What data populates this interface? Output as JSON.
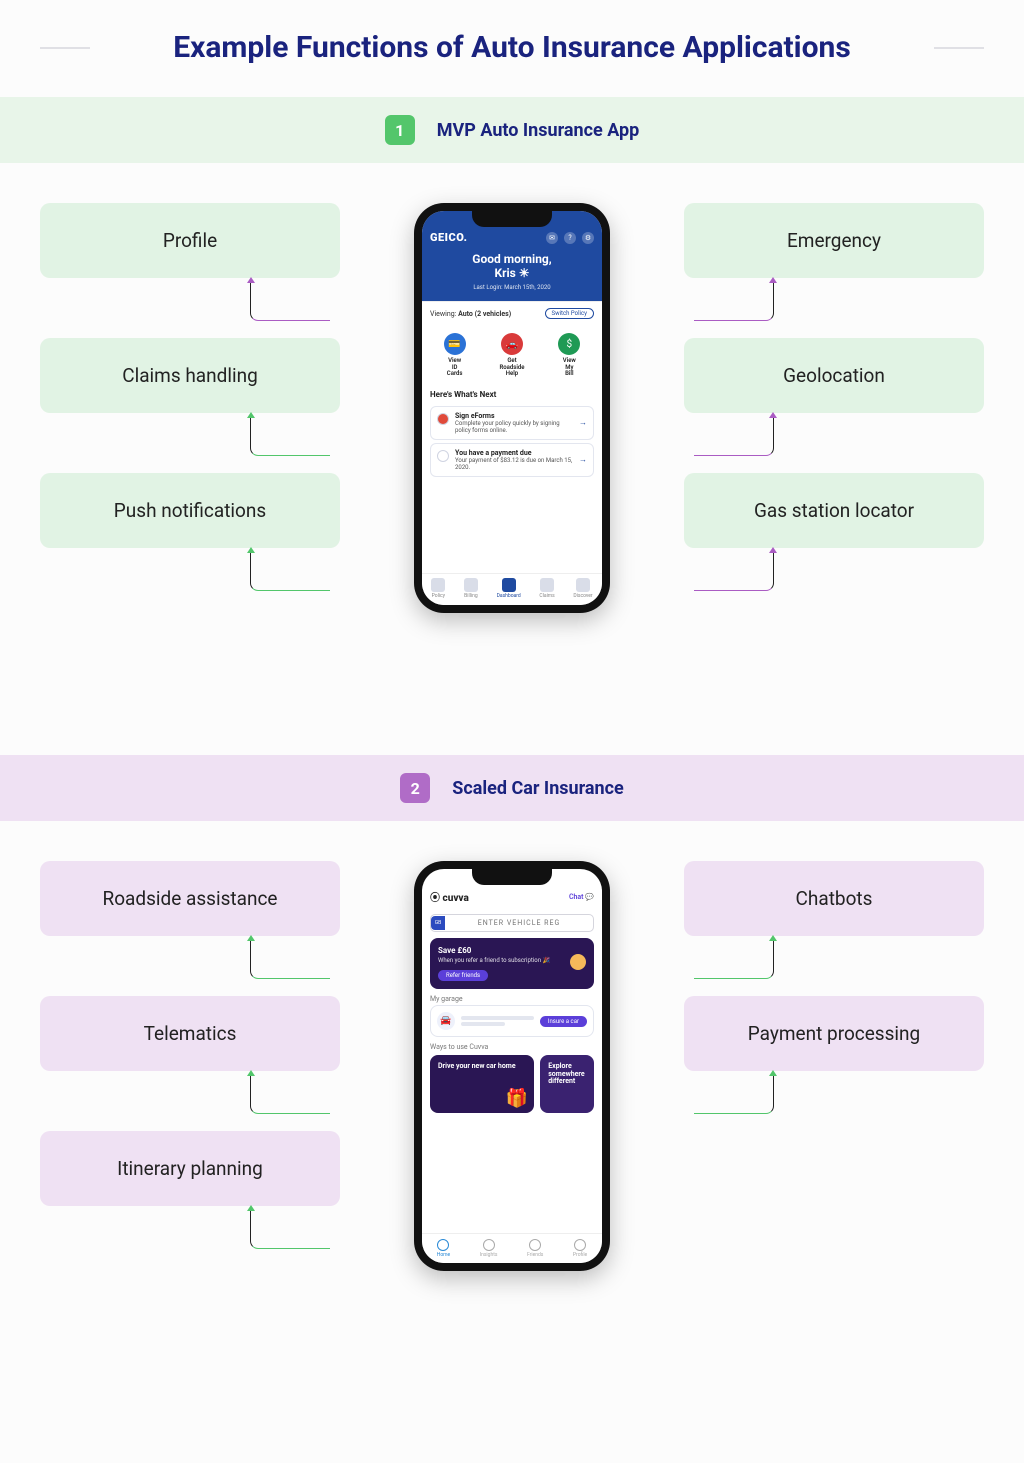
{
  "title": "Example Functions of Auto Insurance Applications",
  "sections": [
    {
      "num": "1",
      "title": "MVP Auto Insurance App",
      "theme": "g",
      "left": [
        "Profile",
        "Claims handling",
        "Push notifications"
      ],
      "right": [
        "Emergency",
        "Geolocation",
        "Gas station locator"
      ],
      "conn_left": [
        "cp",
        "cg",
        "cg"
      ],
      "conn_right": [
        "cp",
        "cp",
        "cp"
      ]
    },
    {
      "num": "2",
      "title": "Scaled Car Insurance",
      "theme": "p",
      "left": [
        "Roadside assistance",
        "Telematics",
        "Itinerary planning"
      ],
      "right": [
        "Chatbots",
        "Payment processing"
      ],
      "conn_left": [
        "cg",
        "cg",
        "cg"
      ],
      "conn_right": [
        "cg",
        "cg"
      ]
    }
  ],
  "geico": {
    "brand": "GEICO.",
    "greeting_line1": "Good morning,",
    "greeting_line2": "Kris ☀",
    "last_login": "Last Login: March 15th, 2020",
    "viewing_label": "Viewing:",
    "viewing_value": "Auto (2 vehicles)",
    "switch": "Switch Policy",
    "quick": [
      {
        "label": "View ID Cards",
        "color": "#2b72d6",
        "icon": "💳"
      },
      {
        "label": "Get Roadside Help",
        "color": "#d93a3a",
        "icon": "🚗"
      },
      {
        "label": "View My Bill",
        "color": "#1f9a55",
        "icon": "$"
      }
    ],
    "next_header": "Here's What's Next",
    "cards": [
      {
        "dot": "#e04a3a",
        "title": "Sign eForms",
        "desc": "Complete your policy quickly by signing policy forms online."
      },
      {
        "dot": "#ffffff",
        "title": "You have a payment due",
        "desc": "Your payment of $83.12 is due on March 15, 2020."
      }
    ],
    "tabs": [
      "Policy",
      "Billing",
      "Dashboard",
      "Claims",
      "Discover"
    ],
    "active_tab": 2
  },
  "cuvva": {
    "brand": "⦿ cuvva",
    "chat": "Chat",
    "gb": "GB",
    "reg_placeholder": "ENTER VEHICLE REG",
    "promo_title": "Save £60",
    "promo_desc": "When you refer a friend to subscription 🎉",
    "promo_btn": "Refer friends",
    "garage_label": "My garage",
    "insure_btn": "Insure a car",
    "ways_label": "Ways to use Cuvva",
    "way1": "Drive your new car home",
    "way2": "Explore somewhere different",
    "tabs": [
      "Home",
      "Insights",
      "Friends",
      "Profile"
    ],
    "active_tab": 0
  }
}
